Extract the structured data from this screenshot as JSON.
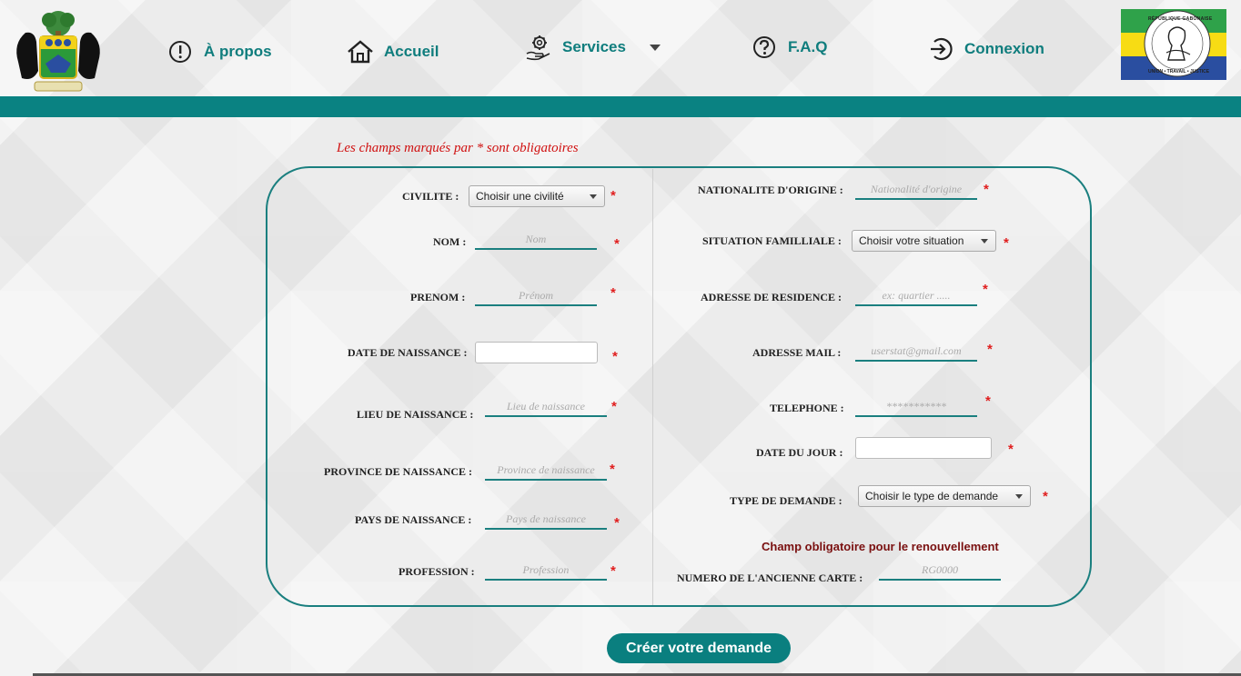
{
  "nav": {
    "about": "À propos",
    "home": "Accueil",
    "services": "Services",
    "faq": "F.A.Q",
    "login": "Connexion"
  },
  "brand": {
    "teal": "#0a8282",
    "flag_colors": [
      "#2fa24a",
      "#f7dc14",
      "#2a4ea0"
    ],
    "seal_text": "RÉPUBLIQUE GABONAISE",
    "seal_motto": "UNION • TRAVAIL • JUSTICE"
  },
  "form": {
    "required_note": "Les champs marqués par * sont obligatoires",
    "star": "*",
    "civilite": {
      "label": "CIVILITE :",
      "value": "Choisir une civilité"
    },
    "nom": {
      "label": "NOM :",
      "placeholder": "Nom"
    },
    "prenom": {
      "label": "PRENOM :",
      "placeholder": "Prénom"
    },
    "date_naissance": {
      "label": "DATE DE NAISSANCE :"
    },
    "lieu_naissance": {
      "label": "LIEU DE NAISSANCE :",
      "placeholder": "Lieu de naissance"
    },
    "province_naissance": {
      "label": "PROVINCE DE NAISSANCE :",
      "placeholder": "Province de naissance"
    },
    "pays_naissance": {
      "label": "PAYS DE NAISSANCE :",
      "placeholder": "Pays de naissance"
    },
    "profession": {
      "label": "PROFESSION :",
      "placeholder": "Profession"
    },
    "nationalite": {
      "label": "NATIONALITE D'ORIGINE :",
      "placeholder": "Nationalité d'origine"
    },
    "situation": {
      "label": "SITUATION FAMILLIALE :",
      "value": "Choisir votre situation"
    },
    "adresse": {
      "label": "ADRESSE DE RESIDENCE :",
      "placeholder": "ex: quartier ....."
    },
    "mail": {
      "label": "ADRESSE MAIL :",
      "placeholder": "userstat@gmail.com"
    },
    "telephone": {
      "label": "TELEPHONE :",
      "placeholder": "***********"
    },
    "date_jour": {
      "label": "DATE DU JOUR :"
    },
    "type_demande": {
      "label": "TYPE DE DEMANDE :",
      "value": "Choisir le type de demande"
    },
    "renew_title": "Champ obligatoire pour le renouvellement",
    "ancienne_carte": {
      "label": "NUMERO DE L'ANCIENNE CARTE :",
      "placeholder": "RG0000"
    },
    "submit": "Créer votre demande"
  }
}
